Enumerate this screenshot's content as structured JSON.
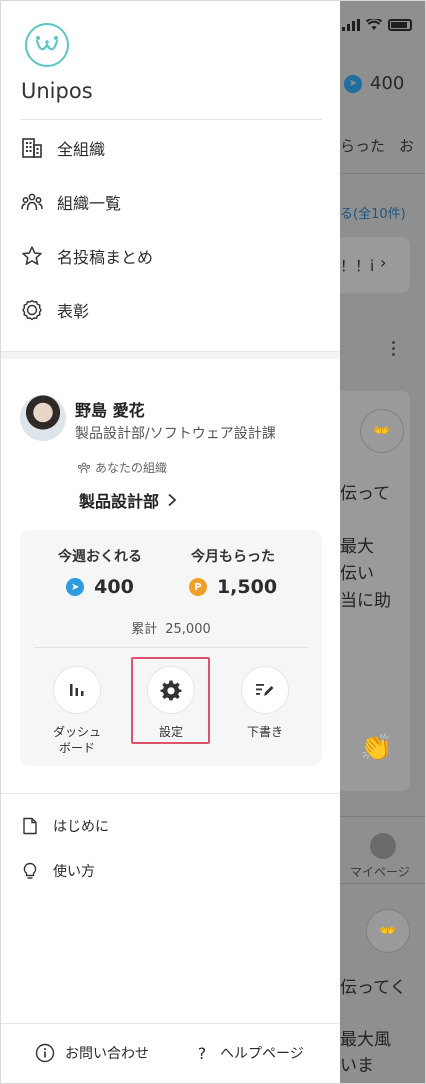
{
  "background": {
    "points": "400",
    "tabs": [
      "らった",
      "お"
    ],
    "link": "る(全10件)",
    "card_text": "！！i",
    "post_lines": [
      "伝って",
      "最大",
      "伝い",
      "当に助"
    ],
    "post_lines_2": [
      "伝ってく",
      "最大風",
      "いま"
    ],
    "my_page": "マイページ"
  },
  "drawer": {
    "brand": "Unipos",
    "nav": [
      {
        "label": "全組織",
        "icon": "building-icon"
      },
      {
        "label": "組織一覧",
        "icon": "group-icon"
      },
      {
        "label": "名投稿まとめ",
        "icon": "star-icon"
      },
      {
        "label": "表彰",
        "icon": "award-icon"
      }
    ],
    "user": {
      "name": "野島 愛花",
      "department": "製品設計部/ソフトウェア設計課",
      "org_label": "あなたの組織",
      "org_name": "製品設計部"
    },
    "points": {
      "send_label": "今週おくれる",
      "send_value": "400",
      "received_label": "今月もらった",
      "received_value": "1,500",
      "total_label": "累計",
      "total_value": "25,000"
    },
    "actions": [
      {
        "label": "ダッシュ\nボード",
        "icon": "bar-chart-icon"
      },
      {
        "label": "設定",
        "icon": "gear-icon"
      },
      {
        "label": "下書き",
        "icon": "edit-icon"
      }
    ],
    "sub_items": [
      {
        "label": "はじめに",
        "icon": "document-icon"
      },
      {
        "label": "使い方",
        "icon": "lightbulb-icon"
      }
    ],
    "footer": {
      "contact": "お問い合わせ",
      "help": "ヘルプページ"
    }
  },
  "colors": {
    "accent_teal": "#5bc7c2",
    "blue_coin": "#2e9be0",
    "orange_coin": "#f0a02a",
    "highlight": "#e0516e"
  }
}
